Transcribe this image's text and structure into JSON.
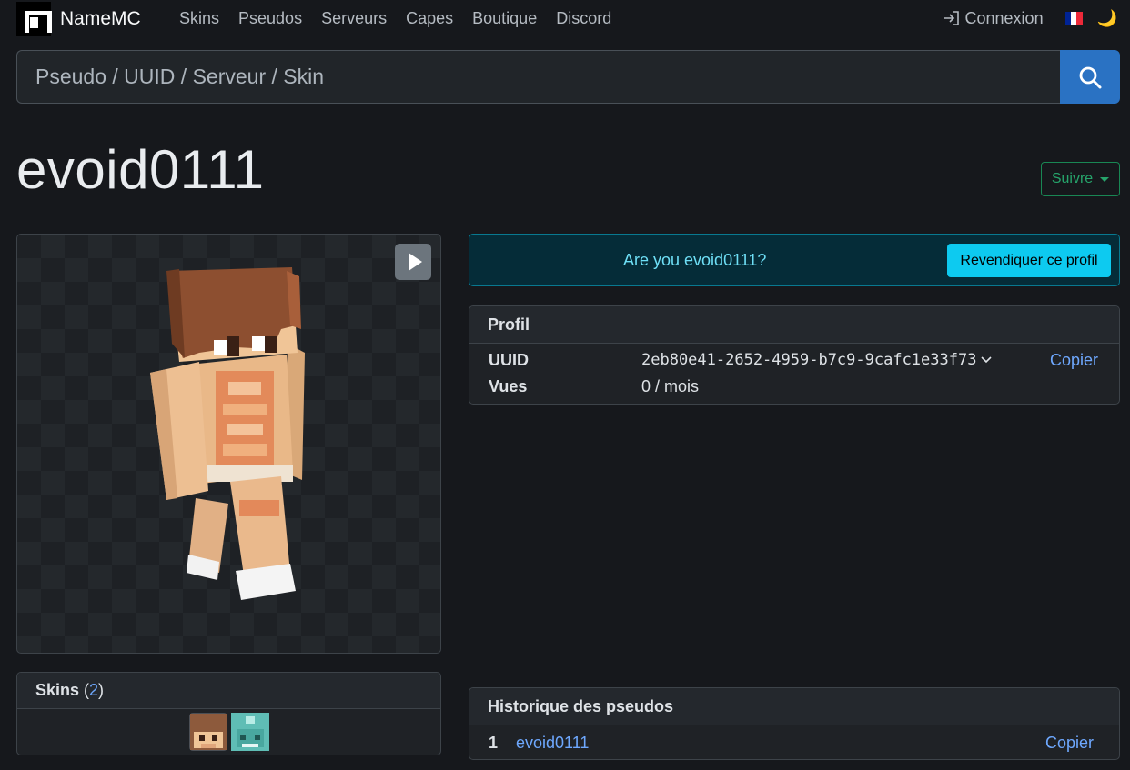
{
  "brand": {
    "name": "NameMC"
  },
  "nav": {
    "links": [
      "Skins",
      "Pseudos",
      "Serveurs",
      "Capes",
      "Boutique",
      "Discord"
    ],
    "login": "Connexion",
    "flag_colors": [
      "#002395",
      "#ffffff",
      "#ed2939"
    ]
  },
  "search": {
    "placeholder": "Pseudo / UUID / Serveur / Skin",
    "value": ""
  },
  "profile_header": {
    "username": "evoid0111",
    "follow_label": "Suivre"
  },
  "skins": {
    "label": "Skins",
    "count": "2"
  },
  "claim": {
    "question": "Are you evoid0111?",
    "button": "Revendiquer ce profil"
  },
  "profile": {
    "title": "Profil",
    "uuid_label": "UUID",
    "uuid_value": "2eb80e41-2652-4959-b7c9-9cafc1e33f73",
    "copy_label": "Copier",
    "views_label": "Vues",
    "views_value": "0 / mois"
  },
  "history": {
    "title": "Historique des pseudos",
    "entries": [
      {
        "num": "1",
        "name": "evoid0111",
        "copy": "Copier"
      }
    ]
  },
  "colors": {
    "accent": "#2a72c3",
    "link": "#6ea8fe",
    "follow": "#198754",
    "info": "#0dcaf0"
  }
}
